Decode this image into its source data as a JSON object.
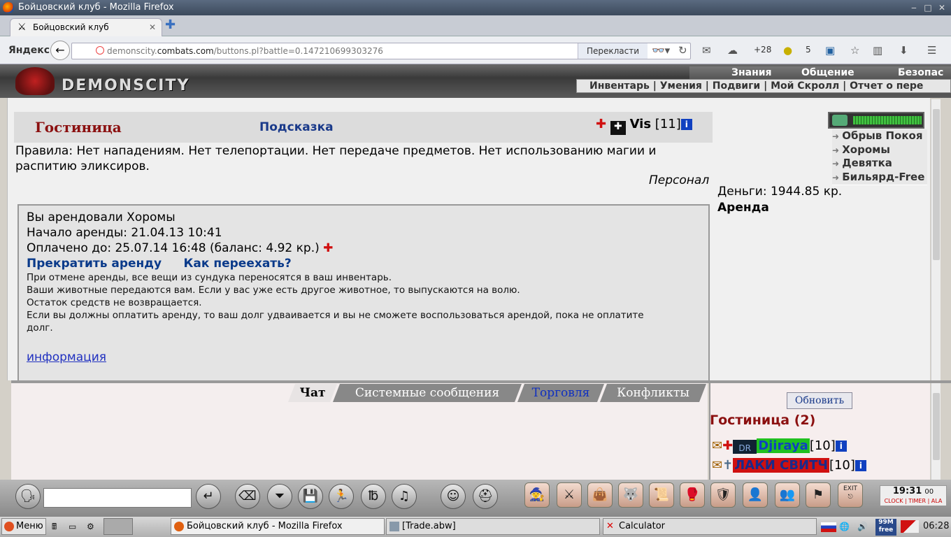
{
  "window": {
    "title": "Бойцовский клуб - Mozilla Firefox"
  },
  "browser": {
    "tab_title": "Бойцовский клуб",
    "search_brand": "Яндекс",
    "url_prefix": "demonscity.",
    "url_domain": "combats.com",
    "url_path": "/buttons.pl?battle=0.147210699303276",
    "translate_label": "Перекласти",
    "weather": "+28",
    "badge_count": "5"
  },
  "game": {
    "brand": "DEMONSCITY",
    "top_menu": [
      "Знания",
      "Общение",
      "Безопас"
    ],
    "sub_menu": "Инвентарь | Умения | Подвиги | Мой Скролл | Отчет о пере",
    "location_title": "Гостиница",
    "hint_link": "Подсказка",
    "user": {
      "name": "Vis",
      "level": "[11]"
    },
    "rules": "Правила: Нет нападениям. Нет телепортации. Нет передаче предметов. Нет использованию магии и распитию эликсиров.",
    "personal": "Персонал",
    "panel": {
      "line1": "Вы арендовали Хоромы",
      "line2": "Начало аренды: 21.04.13 10:41",
      "line3": "Оплачено до: 25.07.14 16:48 (баланс: 4.92 кр.)",
      "link_stop": "Прекратить аренду",
      "link_move": "Как переехать?",
      "note1": "При отмене аренды, все вещи из сундука переносятся в ваш инвентарь.",
      "note2": "Ваши животные передаются вам. Если у вас уже есть другое животное, то выпускаются на волю.",
      "note3": "Остаток средств не возвращается.",
      "note4a": "Если вы должны оплатить аренду, то ваш долг удваивается и вы не сможете воспользоваться арендой, пока не оплатите",
      "note4b": "долг.",
      "info_link": "информация"
    },
    "right": {
      "rooms": [
        "Обрыв Покоя",
        "Хоромы",
        "Девятка",
        "Бильярд-Free"
      ],
      "money": "Деньги: 1944.85 кр.",
      "rent": "Аренда"
    },
    "chat_tabs": [
      "Чат",
      "Системные сообщения",
      "Торговля",
      "Конфликты"
    ],
    "online": {
      "refresh": "Обновить",
      "header": "Гостиница (2)",
      "players": [
        {
          "name": "Djiraya",
          "level": "[10]"
        },
        {
          "name": "ЛАКИ СВИТЧ",
          "level": "[10]"
        }
      ]
    },
    "clock": {
      "time": "19:31",
      "sec": "00",
      "labels": "CLOCK | TIMER | ALA"
    },
    "exit_label": "EXIT"
  },
  "taskbar": {
    "start": "Меню",
    "tasks": [
      "Бойцовский клуб - Mozilla Firefox",
      "[Trade.abw]",
      "Calculator"
    ],
    "mem": "99M free",
    "time": "06:28"
  }
}
